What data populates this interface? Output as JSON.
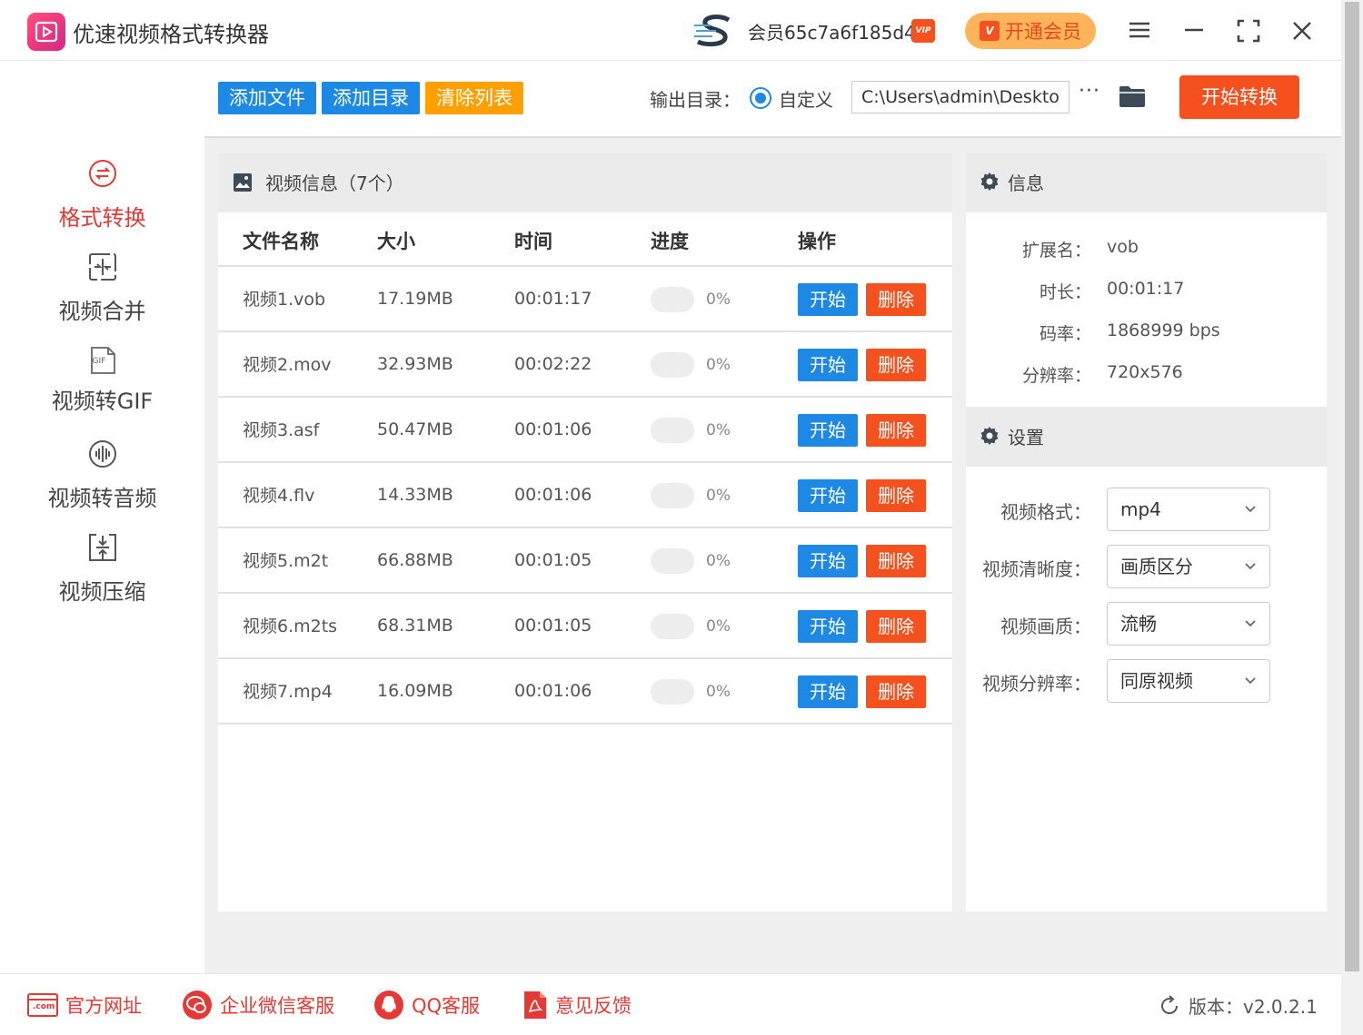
{
  "app": {
    "title": "优速视频格式转换器",
    "member_id": "会员65c7a6f185d4",
    "vip_badge": "VIP",
    "vip_button": "开通会员"
  },
  "sidebar": {
    "items": [
      {
        "label": "格式转换",
        "icon": "format-convert-icon",
        "active": true
      },
      {
        "label": "视频合并",
        "icon": "merge-icon",
        "active": false
      },
      {
        "label": "视频转GIF",
        "icon": "gif-icon",
        "active": false
      },
      {
        "label": "视频转音频",
        "icon": "audio-icon",
        "active": false
      },
      {
        "label": "视频压缩",
        "icon": "compress-icon",
        "active": false
      }
    ],
    "gif_icon_text": "GIF"
  },
  "toolbar": {
    "add_file": "添加文件",
    "add_folder": "添加目录",
    "clear_list": "清除列表",
    "output_label": "输出目录：",
    "radio_label": "自定义",
    "output_path": "C:\\Users\\admin\\Deskto",
    "more": "···",
    "start_convert": "开始转换"
  },
  "video_panel": {
    "title": "视频信息（7个）",
    "columns": {
      "name": "文件名称",
      "size": "大小",
      "time": "时间",
      "progress": "进度",
      "action": "操作"
    },
    "start_label": "开始",
    "delete_label": "删除",
    "rows": [
      {
        "name": "视频1.vob",
        "size": "17.19MB",
        "time": "00:01:17",
        "progress": "0%",
        "progress_value": 0
      },
      {
        "name": "视频2.mov",
        "size": "32.93MB",
        "time": "00:02:22",
        "progress": "0%",
        "progress_value": 0
      },
      {
        "name": "视频3.asf",
        "size": "50.47MB",
        "time": "00:01:06",
        "progress": "0%",
        "progress_value": 0
      },
      {
        "name": "视频4.flv",
        "size": "14.33MB",
        "time": "00:01:06",
        "progress": "0%",
        "progress_value": 0
      },
      {
        "name": "视频5.m2t",
        "size": "66.88MB",
        "time": "00:01:05",
        "progress": "0%",
        "progress_value": 0
      },
      {
        "name": "视频6.m2ts",
        "size": "68.31MB",
        "time": "00:01:05",
        "progress": "0%",
        "progress_value": 0
      },
      {
        "name": "视频7.mp4",
        "size": "16.09MB",
        "time": "00:01:06",
        "progress": "0%",
        "progress_value": 0
      }
    ]
  },
  "info": {
    "title": "信息",
    "items": [
      {
        "label": "扩展名：",
        "value": "vob"
      },
      {
        "label": "时长：",
        "value": "00:01:17"
      },
      {
        "label": "码率：",
        "value": "1868999 bps"
      },
      {
        "label": "分辨率：",
        "value": "720x576"
      }
    ]
  },
  "settings": {
    "title": "设置",
    "items": [
      {
        "label": "视频格式：",
        "value": "mp4"
      },
      {
        "label": "视频清晰度：",
        "value": "画质区分"
      },
      {
        "label": "视频画质：",
        "value": "流畅"
      },
      {
        "label": "视频分辨率：",
        "value": "同原视频"
      }
    ]
  },
  "footer": {
    "website": "官方网址",
    "website_icon_text": ".com",
    "wechat": "企业微信客服",
    "qq": "QQ客服",
    "feedback": "意见反馈",
    "version": "版本：v2.0.2.1"
  },
  "colors": {
    "accent_blue": "#1e88e5",
    "accent_red": "#f4511e",
    "accent_orange": "#ffa000",
    "active_red": "#e53935"
  }
}
